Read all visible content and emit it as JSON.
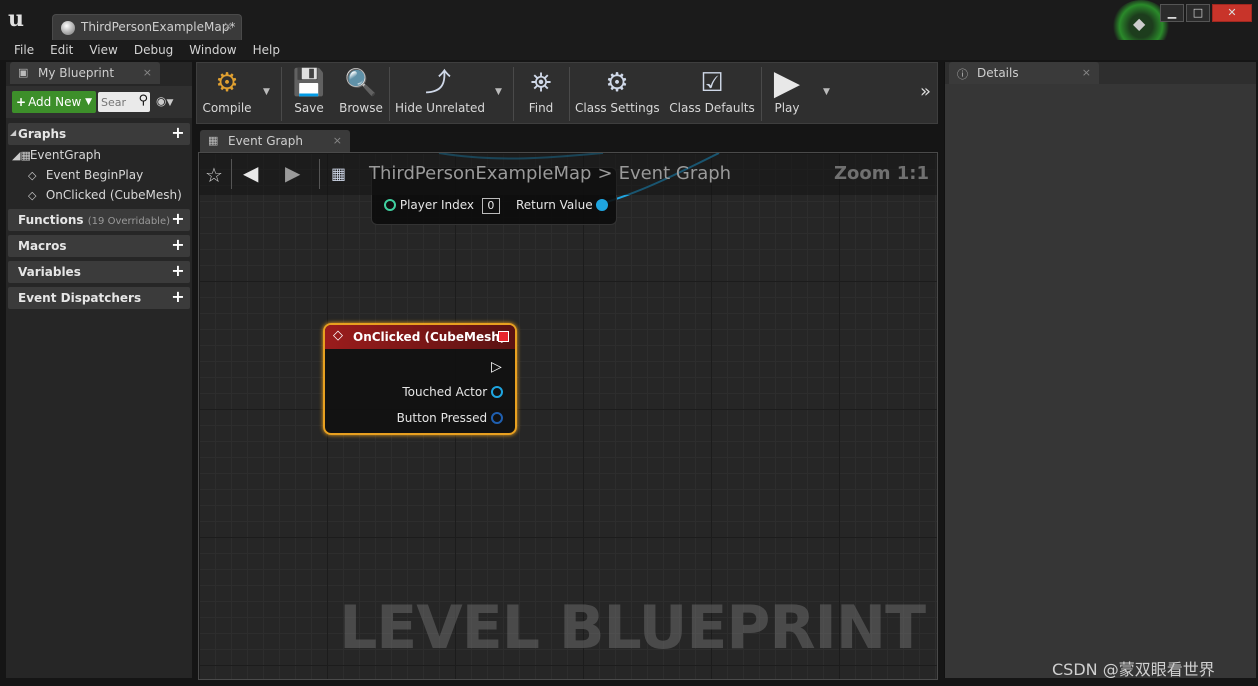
{
  "window": {
    "tab_label": "ThirdPersonExampleMap*",
    "tab_close": "×",
    "btn_minimize": "▁",
    "btn_maximize": "□",
    "btn_close": "✕"
  },
  "menu": [
    "File",
    "Edit",
    "View",
    "Debug",
    "Window",
    "Help"
  ],
  "my_blueprint": {
    "tab_label": "My Blueprint",
    "add_new_label": "Add New",
    "search_placeholder": "Sear",
    "sections": {
      "graphs": "Graphs",
      "functions": "Functions",
      "functions_sub": "(19 Overridable)",
      "macros": "Macros",
      "variables": "Variables",
      "event_dispatchers": "Event Dispatchers"
    },
    "tree": {
      "event_graph": "EventGraph",
      "begin_play": "Event BeginPlay",
      "on_clicked": "OnClicked (CubeMesh)"
    }
  },
  "toolbar": {
    "compile": "Compile",
    "save": "Save",
    "browse": "Browse",
    "hide_unrelated": "Hide Unrelated",
    "find": "Find",
    "class_settings": "Class Settings",
    "class_defaults": "Class Defaults",
    "play": "Play"
  },
  "graph": {
    "tab_label": "Event Graph",
    "breadcrumb_root": "ThirdPersonExampleMap",
    "breadcrumb_sep": ">",
    "breadcrumb_leaf": "Event Graph",
    "zoom": "Zoom 1:1",
    "watermark": "LEVEL BLUEPRINT",
    "top_node": {
      "player_index_label": "Player Index",
      "player_index_value": "0",
      "return_value_label": "Return Value"
    },
    "event_node": {
      "title": "OnClicked (CubeMesh)",
      "pin_touched_actor": "Touched Actor",
      "pin_button_pressed": "Button Pressed"
    }
  },
  "details": {
    "tab_label": "Details"
  },
  "watermark_csdn": "CSDN @蒙双眼看世界",
  "colors": {
    "add_new_green": "#3d8f2a",
    "event_header_red": "#9b1c1c",
    "selection_orange": "#e8a020",
    "pin_blue": "#1fa5e0"
  }
}
